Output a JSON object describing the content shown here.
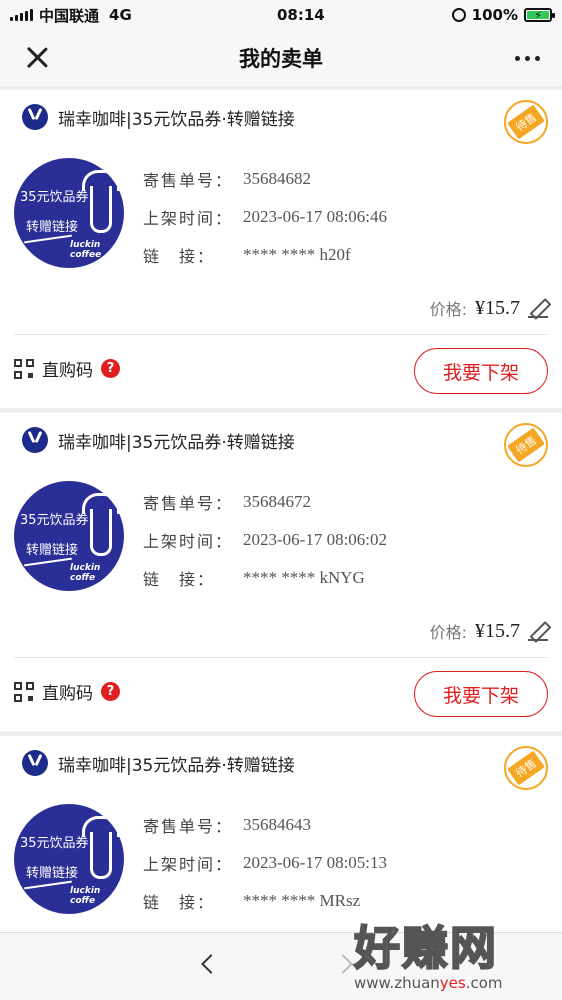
{
  "status_bar": {
    "carrier": "中国联通",
    "network": "4G",
    "time": "08:14",
    "battery": "100%",
    "battery_level": 1.0
  },
  "nav": {
    "title": "我的卖单"
  },
  "labels": {
    "order_no": "寄售单号：",
    "list_time": "上架时间：",
    "link": "链　接：",
    "price": "价格:",
    "direct_buy": "直购码",
    "delist": "我要下架",
    "status_badge": "待售",
    "help": "?"
  },
  "orders": [
    {
      "title": "瑞幸咖啡|35元饮品券·转赠链接",
      "thumb_line1": "35元饮品券",
      "thumb_line2": "转赠链接",
      "thumb_brand": "luckin coffee",
      "order_no": "35684682",
      "list_time": "2023-06-17 08:06:46",
      "link": "**** **** h20f",
      "price": "¥15.7"
    },
    {
      "title": "瑞幸咖啡|35元饮品券·转赠链接",
      "thumb_line1": "35元饮品券",
      "thumb_line2": "转赠链接",
      "thumb_brand": "luckin coffe",
      "order_no": "35684672",
      "list_time": "2023-06-17 08:06:02",
      "link": "**** **** kNYG",
      "price": "¥15.7"
    },
    {
      "title": "瑞幸咖啡|35元饮品券·转赠链接",
      "thumb_line1": "35元饮品券",
      "thumb_line2": "转赠链接",
      "thumb_brand": "luckin coffe",
      "order_no": "35684643",
      "list_time": "2023-06-17 08:05:13",
      "link": "**** **** MRsz"
    }
  ],
  "watermark": {
    "main": "好赚网",
    "sub_a": "www.zhuan",
    "sub_b": "yes",
    "sub_c": ".com"
  },
  "colors": {
    "accent_red": "#e02020",
    "badge_orange": "#f5a623",
    "luckin_blue": "#2a2f97"
  }
}
